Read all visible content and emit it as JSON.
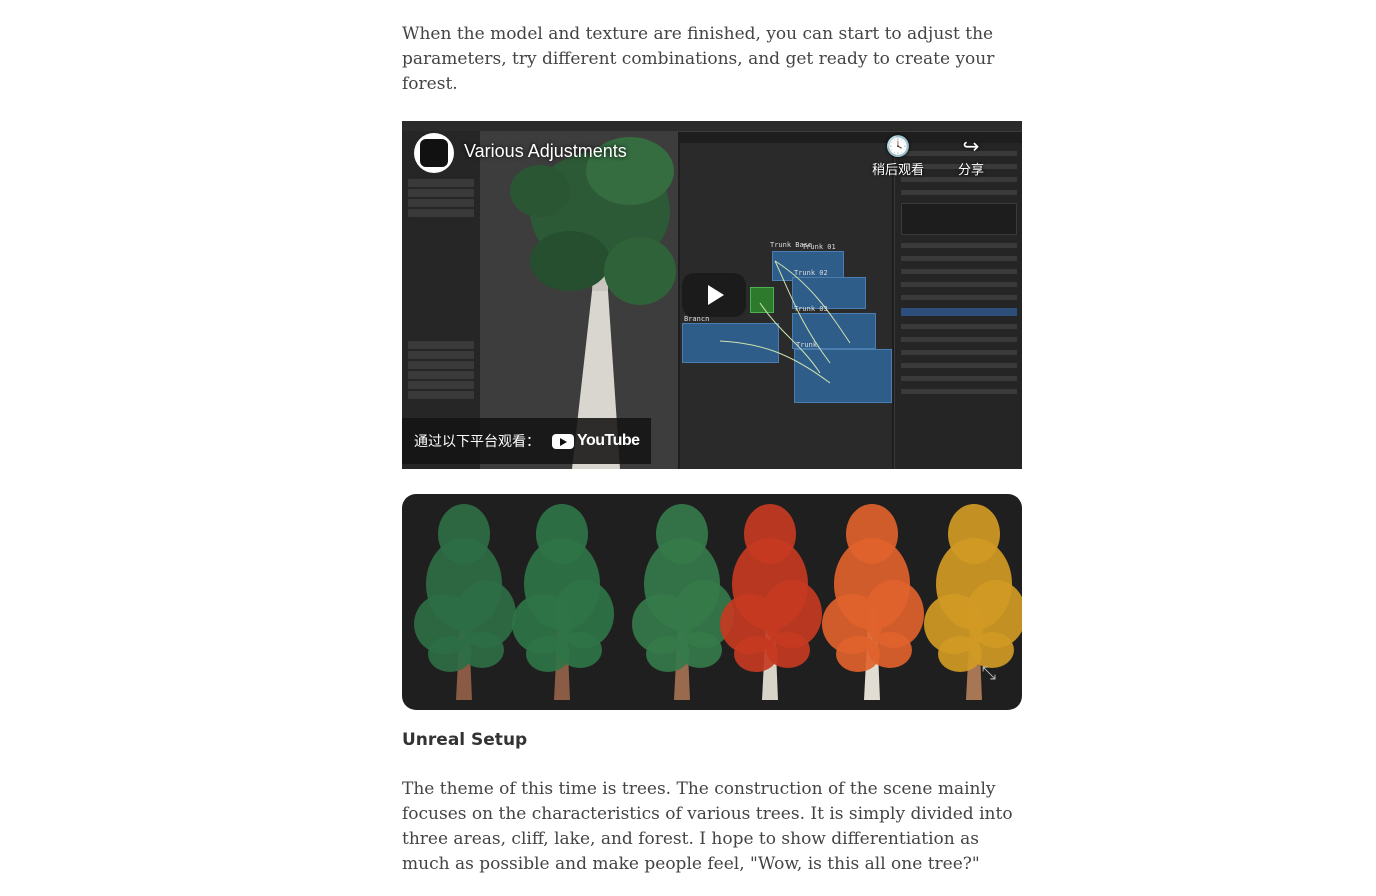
{
  "intro_paragraph": "When the model and texture are finished, you can start to adjust the parameters, try different combinations, and get ready to create your forest.",
  "video": {
    "title": "Various Adjustments",
    "watch_later": "稍后观看",
    "share": "分享",
    "watch_on": "通过以下平台观看：",
    "platform": "YouTube",
    "node_labels": [
      "Trunk Base",
      "Trunk 01",
      "Trunk 02",
      "Trunk 03",
      "Branch",
      "Trunk"
    ]
  },
  "gallery": {
    "trees": [
      {
        "foliage": "#2e6e45"
      },
      {
        "foliage": "#2f7447"
      },
      {
        "foliage": "#357a4a"
      },
      {
        "foliage": "#c63a22"
      },
      {
        "foliage": "#e0622c"
      },
      {
        "foliage": "#d19a24"
      }
    ]
  },
  "section_heading": "Unreal Setup",
  "body_paragraph": "The theme of this time is trees. The construction of the scene mainly focuses on the characteristics of various trees. It is simply divided into three areas, cliff, lake, and forest. I hope to show differentiation as much as possible and make people feel, \"Wow, is this all one tree?\""
}
